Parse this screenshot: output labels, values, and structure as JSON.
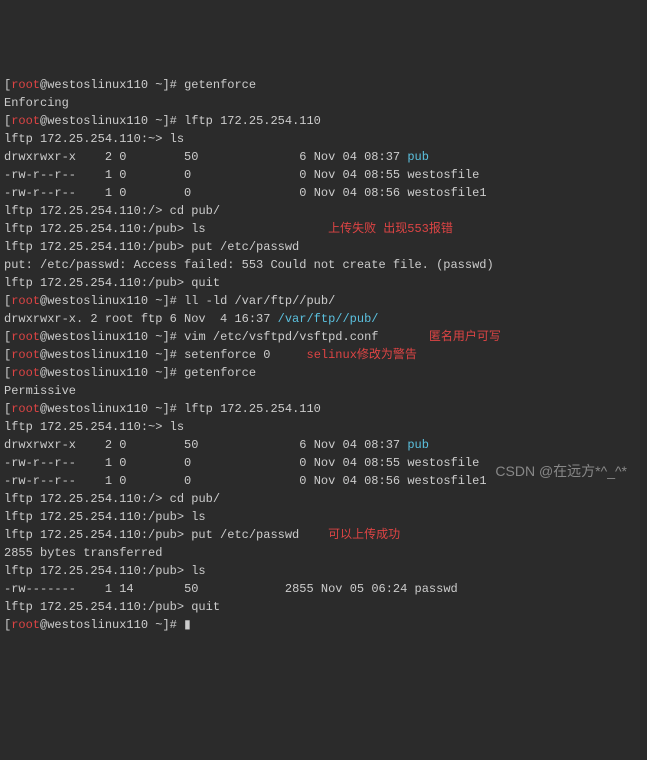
{
  "prompt_user": "root",
  "prompt_host": "westoslinux110",
  "prompt_dir": "~",
  "prompt_suffix": "]#",
  "cmd_getenforce": "getenforce",
  "getenforce_out1": "Enforcing",
  "cmd_lftp": "lftp 172.25.254.110",
  "lftp_prompt_root": "lftp 172.25.254.110:~>",
  "lftp_prompt_slash": "lftp 172.25.254.110:/>",
  "lftp_prompt_pub": "lftp 172.25.254.110:/pub>",
  "ls_cmd": "ls",
  "cd_pub_cmd": "cd pub/",
  "put_cmd": "put /etc/passwd",
  "quit_cmd": "quit",
  "listing1_row1": {
    "perm": "drwxrwxr-x",
    "n": "2",
    "o": "0",
    "sz": "50",
    "bytes": "6",
    "date": "Nov 04 08:37",
    "name": "pub"
  },
  "listing1_row2": {
    "perm": "-rw-r--r--",
    "n": "1",
    "o": "0",
    "sz": "0",
    "bytes": "0",
    "date": "Nov 04 08:55",
    "name": "westosfile"
  },
  "listing1_row3": {
    "perm": "-rw-r--r--",
    "n": "1",
    "o": "0",
    "sz": "0",
    "bytes": "0",
    "date": "Nov 04 08:56",
    "name": "westosfile1"
  },
  "annot_fail": "上传失败 出现553报错",
  "put_error": "put: /etc/passwd: Access failed: 553 Could not create file. (passwd)",
  "cmd_ll": "ll -ld /var/ftp//pub/",
  "ll_out_perm": "drwxrwxr-x. 2 root ftp 6 Nov  4 16:37 ",
  "ll_out_path": "/var/ftp//pub/",
  "cmd_vim": "vim /etc/vsftpd/vsftpd.conf",
  "annot_anon": "匿名用户可写",
  "cmd_setenforce": "setenforce 0",
  "annot_selinux": "selinux修改为警告",
  "getenforce_out2": "Permissive",
  "annot_success": "可以上传成功",
  "bytes_transferred": "2855 bytes transferred",
  "listing2_row1": {
    "perm": "-rw-------",
    "n": "1",
    "o": "14",
    "sz": "50",
    "bytes": "2855",
    "date": "Nov 05 06:24",
    "name": "passwd"
  },
  "watermark": "CSDN @在远方*^_^*"
}
